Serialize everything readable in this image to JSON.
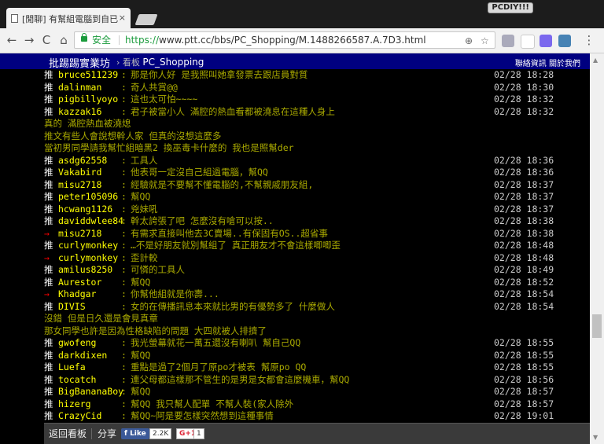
{
  "browser": {
    "tab_title": "[閒聊] 有幫組電腦到自已",
    "tab_close": "×",
    "profile_label": "PCDIY!!!",
    "nav": {
      "back": "←",
      "forward": "→",
      "reload": "C",
      "home": "⌂"
    },
    "secure_label": "安全",
    "url_scheme": "https://",
    "url_rest": "www.ptt.cc/bbs/PC_Shopping/M.1488266587.A.7D3.html",
    "search_glyph": "⊕",
    "star_glyph": "☆",
    "menu_glyph": "⋮"
  },
  "header": {
    "site_title": "批踢踢實業坊",
    "board_prefix": "› 看板",
    "board_name": "PC_Shopping",
    "links": "聯絡資訊  關於我們"
  },
  "comments": [
    {
      "tag": "推",
      "user": "bruce511239",
      "text": "那是你人好  是我照叫她拿發票去跟店員對質",
      "time": "02/28 18:28"
    },
    {
      "tag": "推",
      "user": "dalinman",
      "text": "奇人共賞@@",
      "time": "02/28 18:30"
    },
    {
      "tag": "推",
      "user": "pigbillyoyo",
      "text": "這也太可怕~~~~",
      "time": "02/28 18:32"
    },
    {
      "tag": "推",
      "user": "kazzak16",
      "text": "君子被當小人 滿腔的熱血看都被澆息在這種人身上",
      "time": "02/28 18:32"
    },
    {
      "cont": "真的 滿腔熱血被澆熄"
    },
    {
      "cont": "推文有些人會說想幹人家 但真的沒想這麼多"
    },
    {
      "cont": "當初男同學請我幫忙組暗黑2 換巫毒卡什麼的 我也是照幫der"
    },
    {
      "tag": "推",
      "user": "asdg62558",
      "text": "工具人",
      "time": "02/28 18:36"
    },
    {
      "tag": "推",
      "user": "Vakabird",
      "text": "他表哥一定沒自己組過電腦，幫QQ",
      "time": "02/28 18:36"
    },
    {
      "tag": "推",
      "user": "misu2718",
      "text": "經驗就是不要幫不懂電腦的,不幫親戚朋友組,",
      "time": "02/28 18:37"
    },
    {
      "tag": "推",
      "user": "peter105096",
      "text": "幫QQ",
      "time": "02/28 18:37"
    },
    {
      "tag": "推",
      "user": "hcwang1126",
      "text": "兇妹吼",
      "time": "02/28 18:37"
    },
    {
      "tag": "推",
      "user": "daviddwlee84",
      "text": "幹太誇張了吧 怎麼沒有嗆可以按..",
      "time": "02/28 18:38"
    },
    {
      "tag": "→",
      "user": "misu2718",
      "text": "有需求直接叫他去3C賣場..有保固有OS..超省事",
      "time": "02/28 18:38"
    },
    {
      "tag": "推",
      "user": "curlymonkey",
      "text": "…不是好朋友就別幫組了 真正朋友才不會這樣唧唧歪",
      "time": "02/28 18:48"
    },
    {
      "tag": "→",
      "user": "curlymonkey",
      "text": "歪計較",
      "time": "02/28 18:48"
    },
    {
      "tag": "推",
      "user": "amilus8250",
      "text": "可憐的工具人",
      "time": "02/28 18:49"
    },
    {
      "tag": "推",
      "user": "Aurestor",
      "text": "幫QQ",
      "time": "02/28 18:52"
    },
    {
      "tag": "→",
      "user": "Khadgar",
      "text": "你幫他組就是你壽...",
      "time": "02/28 18:54"
    },
    {
      "tag": "推",
      "user": "DIVIS",
      "text": "女的在傳播訊息本來就比男的有優勢多了 什麼做人",
      "time": "02/28 18:54"
    },
    {
      "cont": "沒錯 但是日久還是會見真章"
    },
    {
      "cont": "那女同學也許是因為性格缺陷的問題 大四就被人排擠了"
    },
    {
      "tag": "推",
      "user": "gwofeng",
      "text": "我光螢幕就花一萬五還沒有喇叭 幫自己QQ",
      "time": "02/28 18:55"
    },
    {
      "tag": "推",
      "user": "darkdixen",
      "text": "幫QQ",
      "time": "02/28 18:55"
    },
    {
      "tag": "推",
      "user": "Luefa",
      "text": "重點是過了2個月了原po才被表 幫原po QQ",
      "time": "02/28 18:55"
    },
    {
      "tag": "推",
      "user": "tocatch",
      "text": "連父母都這樣那不管生的是男是女都會這麼機車，幫QQ",
      "time": "02/28 18:56"
    },
    {
      "tag": "推",
      "user": "BigBananaBoy",
      "text": "幫QQ",
      "time": "02/28 18:57"
    },
    {
      "tag": "推",
      "user": "hizerg",
      "text": "幫QQ 我只幫人配單 不幫人裝(家人除外",
      "time": "02/28 18:57"
    },
    {
      "tag": "推",
      "user": "CrazyCid",
      "text": "幫QQ~阿是要怎樣突然想到這種事情",
      "time": "02/28 19:01"
    }
  ],
  "footer": {
    "back_to_board": "返回看板",
    "share": "分享",
    "fb_like": "Like",
    "fb_count": "2.2K",
    "gplus": "G+1",
    "gplus_count": "1"
  },
  "colors": {
    "page_bg": "#000000",
    "header_bg": "#000080",
    "user": "#ffff00",
    "text": "#aaaa00",
    "arrow": "#ff0000"
  }
}
